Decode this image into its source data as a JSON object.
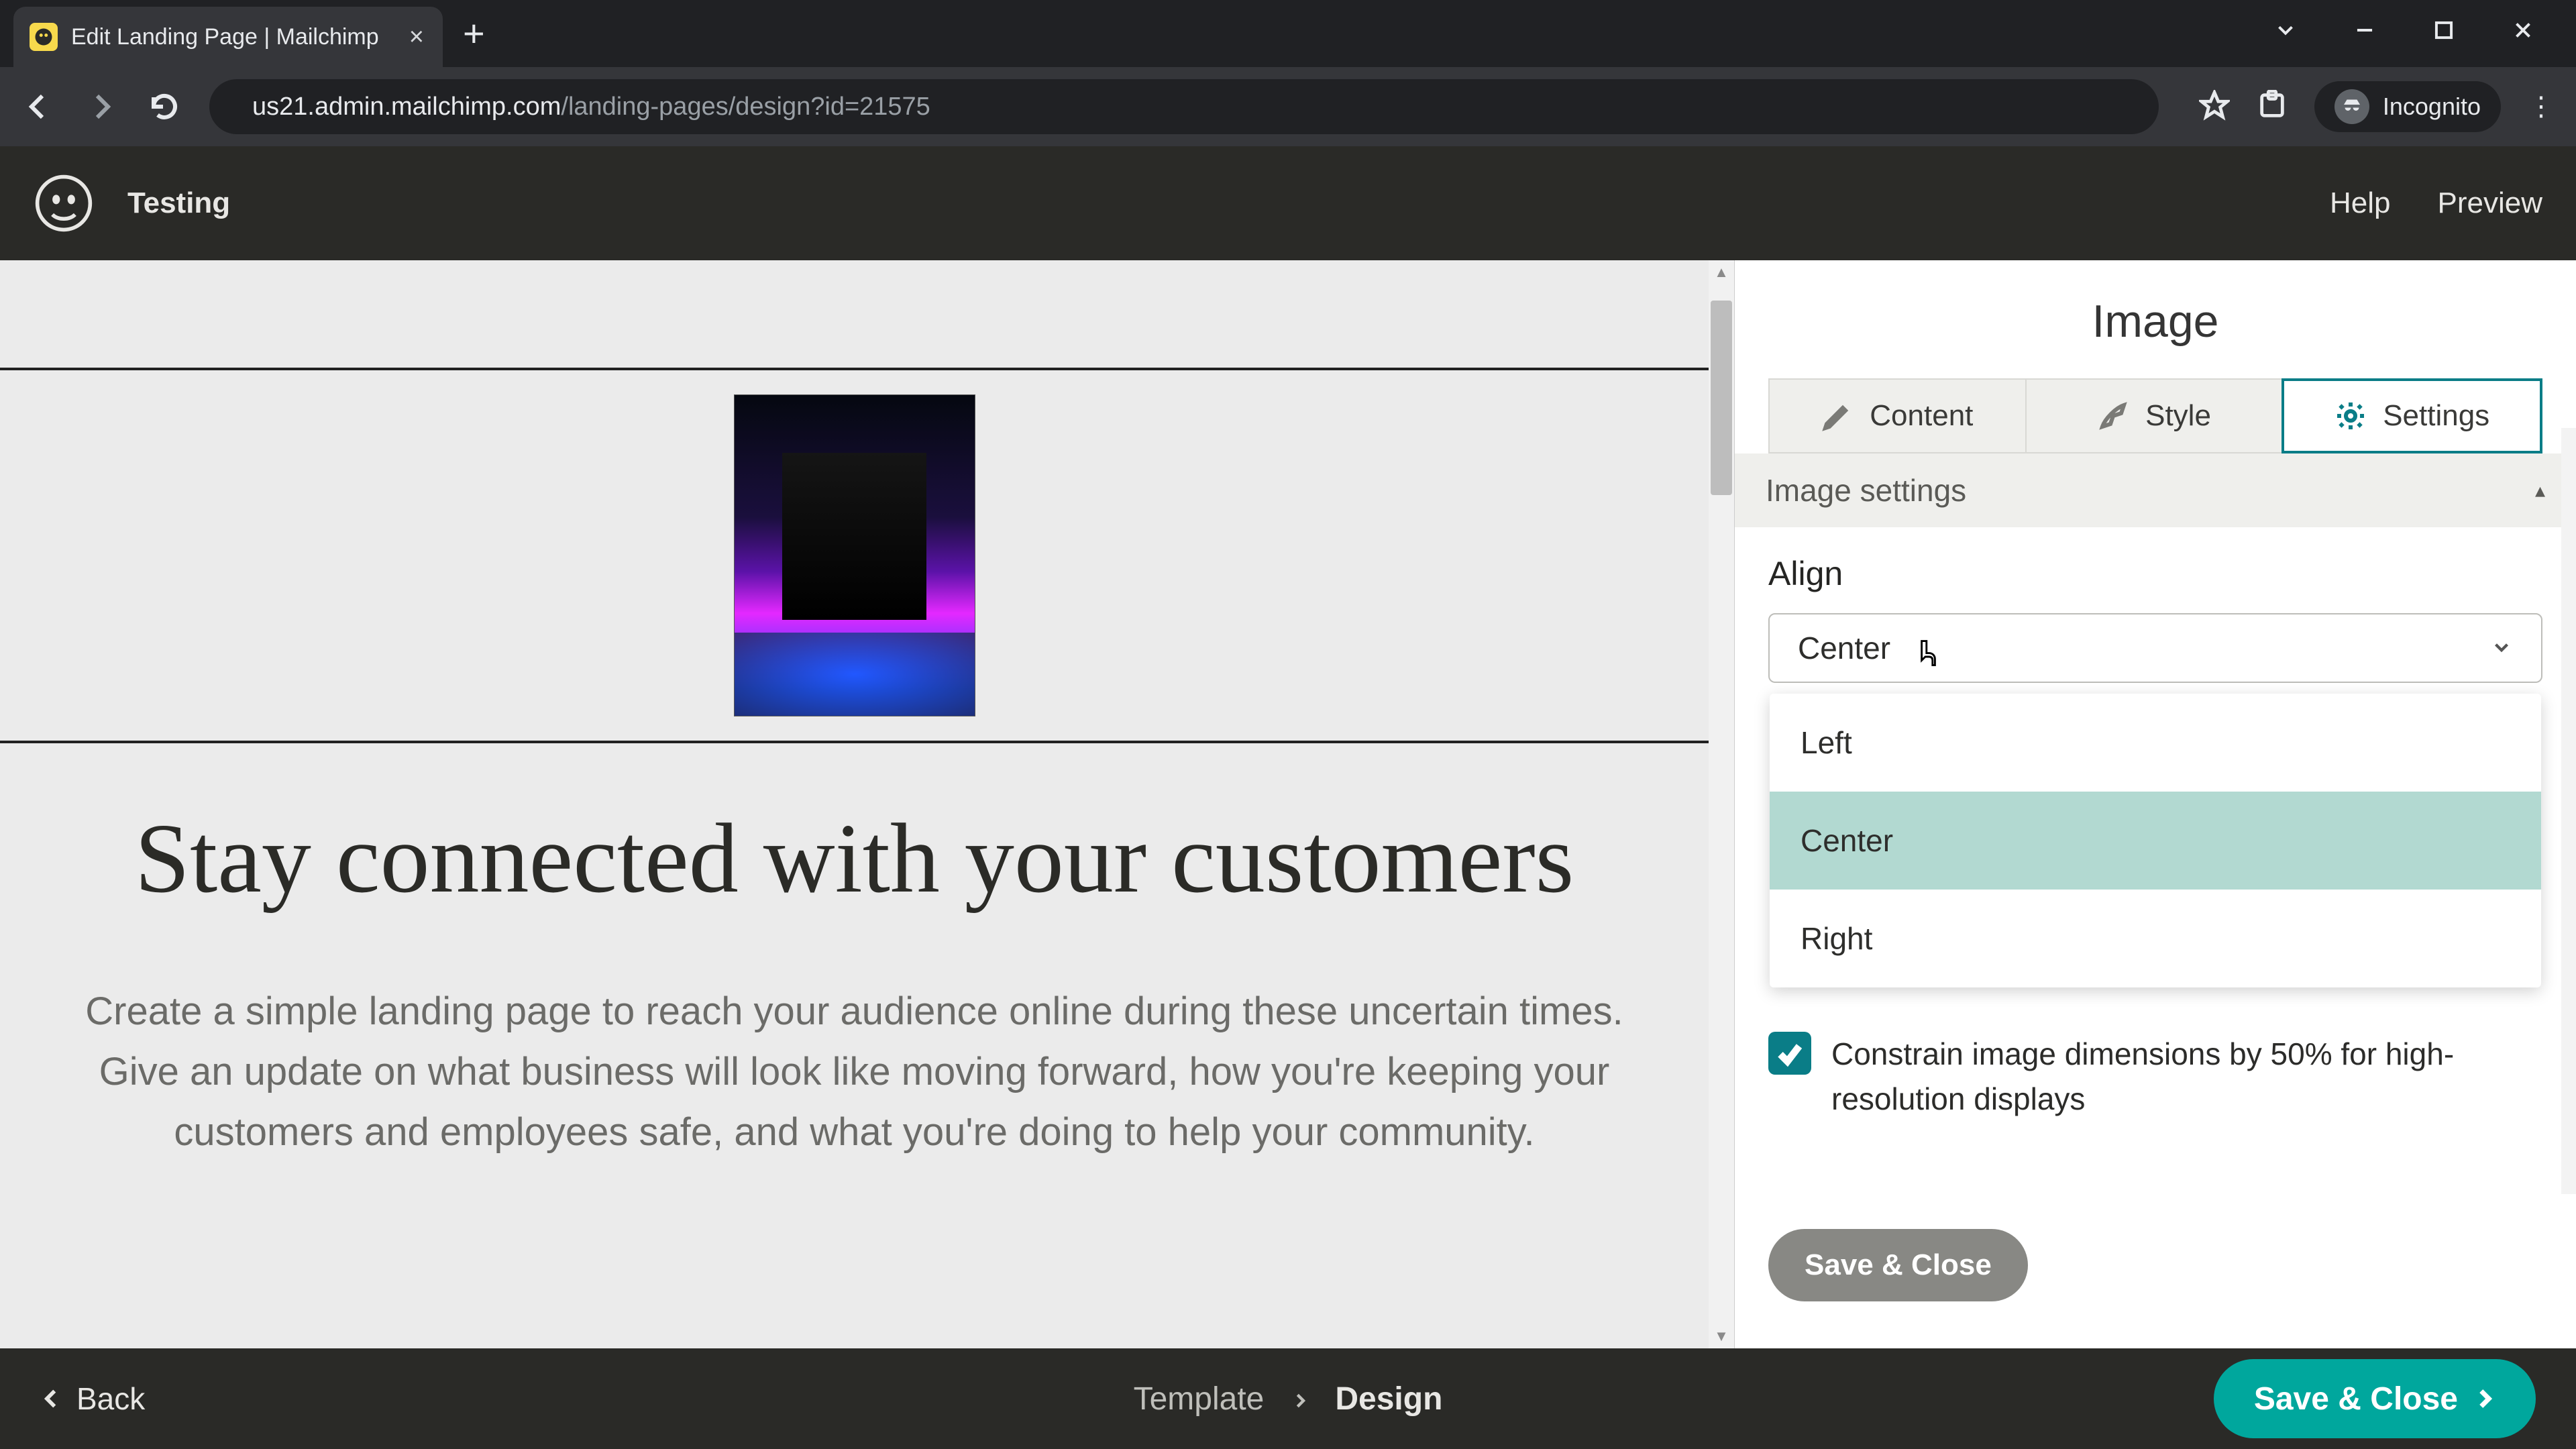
{
  "browser": {
    "tab_title": "Edit Landing Page | Mailchimp",
    "url_host": "us21.admin.mailchimp.com",
    "url_path": "/landing-pages/design?id=21575",
    "incognito_label": "Incognito"
  },
  "header": {
    "page_name": "Testing",
    "help": "Help",
    "preview": "Preview"
  },
  "canvas": {
    "hero_title": "Stay connected with your customers",
    "hero_desc": "Create a simple landing page to reach your audience online during these uncertain times. Give an update on what business will look like moving forward, how you're keeping your customers and employees safe, and what you're doing to help your community."
  },
  "panel": {
    "title": "Image",
    "tabs": {
      "content": "Content",
      "style": "Style",
      "settings": "Settings",
      "active": "settings"
    },
    "section_label": "Image settings",
    "align": {
      "label": "Align",
      "value": "Center",
      "options": [
        "Left",
        "Center",
        "Right"
      ]
    },
    "retina_checkbox": {
      "checked": true,
      "label": "Constrain image dimensions by 50% for high-resolution displays"
    },
    "save_close": "Save & Close"
  },
  "footer": {
    "back": "Back",
    "step_template": "Template",
    "step_design": "Design",
    "primary": "Save & Close"
  }
}
